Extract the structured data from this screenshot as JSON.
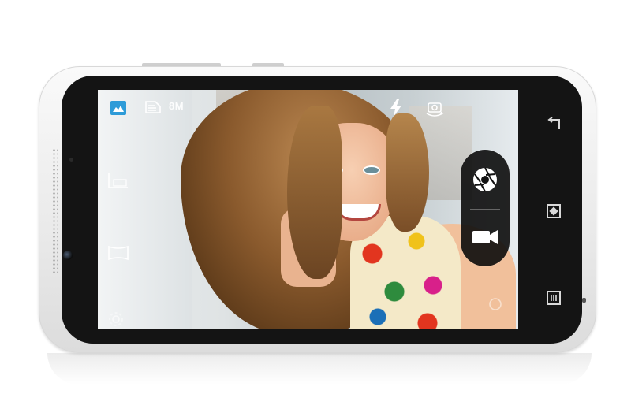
{
  "camera": {
    "resolution_label": "8M",
    "mode_buttons": {
      "photo": "shutter-icon",
      "video": "video-camera-icon"
    },
    "top_icons": [
      "gallery-icon",
      "scene-icon",
      "flash-icon",
      "switch-camera-icon"
    ],
    "left_icons": [
      "hdr-icon",
      "panorama-icon",
      "settings-icon"
    ]
  },
  "hardware_keys": [
    "back-icon",
    "home-icon",
    "menu-icon"
  ],
  "colors": {
    "accent": "#2e9bd8",
    "bezel": "#141414",
    "body": "#eeeeee"
  }
}
